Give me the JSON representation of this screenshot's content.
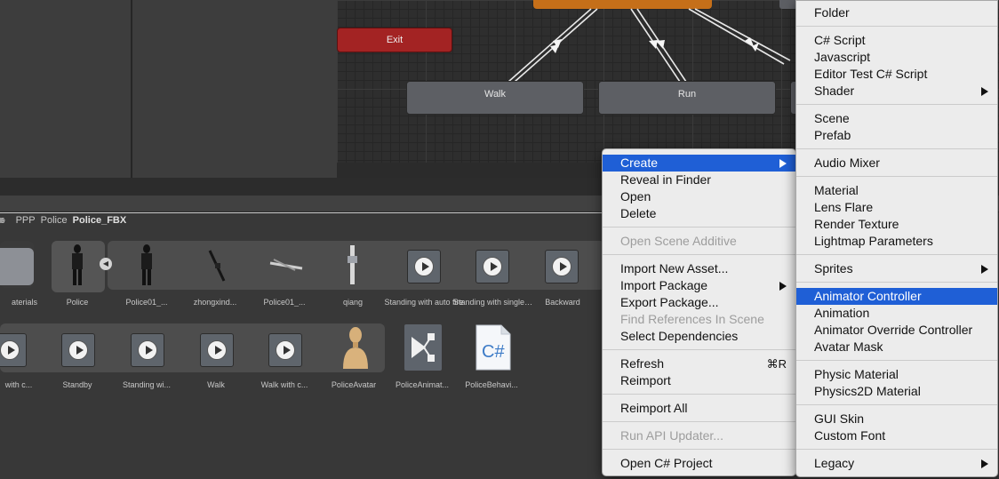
{
  "animator": {
    "exit_label": "Exit",
    "states": [
      "Walk",
      "Run"
    ]
  },
  "breadcrumb": [
    "s",
    "PPP",
    "Police",
    "Police_FBX"
  ],
  "assets_row1": [
    {
      "label": "aterials"
    },
    {
      "label": "Police"
    },
    {
      "label": "Police01_..."
    },
    {
      "label": "zhongxind..."
    },
    {
      "label": "Police01_..."
    },
    {
      "label": "qiang"
    },
    {
      "label": "Standing with auto fire"
    },
    {
      "label": "Standing with single fire"
    },
    {
      "label": "Backward"
    }
  ],
  "assets_row2": [
    {
      "label": "with c..."
    },
    {
      "label": "Standby"
    },
    {
      "label": "Standing wi..."
    },
    {
      "label": "Walk"
    },
    {
      "label": "Walk with c..."
    },
    {
      "label": "PoliceAvatar"
    },
    {
      "label": "PoliceAnimat..."
    },
    {
      "label": "PoliceBehavi..."
    }
  ],
  "context_menu": {
    "create": "Create",
    "reveal": "Reveal in Finder",
    "open": "Open",
    "delete": "Delete",
    "open_scene_additive": "Open Scene Additive",
    "import_new_asset": "Import New Asset...",
    "import_package": "Import Package",
    "export_package": "Export Package...",
    "find_references": "Find References In Scene",
    "select_dependencies": "Select Dependencies",
    "refresh": "Refresh",
    "refresh_shortcut": "⌘R",
    "reimport": "Reimport",
    "reimport_all": "Reimport All",
    "run_api_updater": "Run API Updater...",
    "open_csharp_project": "Open C# Project"
  },
  "create_submenu": {
    "folder": "Folder",
    "csharp_script": "C# Script",
    "javascript": "Javascript",
    "editor_test": "Editor Test C# Script",
    "shader": "Shader",
    "scene": "Scene",
    "prefab": "Prefab",
    "audio_mixer": "Audio Mixer",
    "material": "Material",
    "lens_flare": "Lens Flare",
    "render_texture": "Render Texture",
    "lightmap_parameters": "Lightmap Parameters",
    "sprites": "Sprites",
    "animator_controller": "Animator Controller",
    "animation": "Animation",
    "animator_override": "Animator Override Controller",
    "avatar_mask": "Avatar Mask",
    "physic_material": "Physic Material",
    "physics2d_material": "Physics2D Material",
    "gui_skin": "GUI Skin",
    "custom_font": "Custom Font",
    "legacy": "Legacy"
  },
  "colors": {
    "selection_blue": "#1f5fd6",
    "exit_red": "#a32323",
    "entry_orange": "#c56f19"
  }
}
